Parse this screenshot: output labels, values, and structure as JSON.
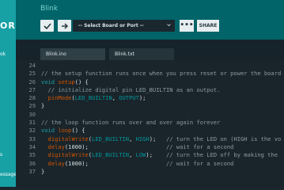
{
  "sidebar": {
    "logo_text": "OR",
    "items": [
      "ok",
      "s",
      "essage"
    ]
  },
  "header": {
    "sketch_name": "Blink",
    "board_placeholder": "-- Select Board or Port --",
    "more_label": "•••",
    "share_label": "SHARE"
  },
  "tabs": [
    {
      "label": "Blink.ino"
    },
    {
      "label": "Blink.txt"
    }
  ],
  "editor": {
    "line_numbers": [
      "24",
      "25",
      "26",
      "27",
      "28",
      "29",
      "30",
      "31",
      "32",
      "33",
      "34",
      "35",
      "36",
      "37"
    ],
    "lines": [
      {
        "segments": [
          {
            "t": "",
            "c": "plain"
          }
        ]
      },
      {
        "segments": [
          {
            "t": "// the setup function runs once when you press reset or power the board",
            "c": "cmt"
          }
        ]
      },
      {
        "segments": [
          {
            "t": "void ",
            "c": "kw"
          },
          {
            "t": "setup",
            "c": "fn"
          },
          {
            "t": "() {",
            "c": "plain"
          }
        ]
      },
      {
        "segments": [
          {
            "t": "  // initialize digital pin LED_BUILTIN as an output.",
            "c": "cmt"
          }
        ]
      },
      {
        "segments": [
          {
            "t": "  ",
            "c": "plain"
          },
          {
            "t": "pinMode",
            "c": "fn"
          },
          {
            "t": "(",
            "c": "plain"
          },
          {
            "t": "LED_BUILTIN",
            "c": "cst"
          },
          {
            "t": ", ",
            "c": "plain"
          },
          {
            "t": "OUTPUT",
            "c": "cst"
          },
          {
            "t": ");",
            "c": "plain"
          }
        ]
      },
      {
        "segments": [
          {
            "t": "}",
            "c": "plain"
          }
        ]
      },
      {
        "segments": [
          {
            "t": "",
            "c": "plain"
          }
        ]
      },
      {
        "segments": [
          {
            "t": "// the loop function runs over and over again forever",
            "c": "cmt"
          }
        ]
      },
      {
        "segments": [
          {
            "t": "void ",
            "c": "kw"
          },
          {
            "t": "loop",
            "c": "fn"
          },
          {
            "t": "() {",
            "c": "plain"
          }
        ]
      },
      {
        "segments": [
          {
            "t": "  ",
            "c": "plain"
          },
          {
            "t": "digitalWrite",
            "c": "fn"
          },
          {
            "t": "(",
            "c": "plain"
          },
          {
            "t": "LED_BUILTIN",
            "c": "cst"
          },
          {
            "t": ", ",
            "c": "plain"
          },
          {
            "t": "HIGH",
            "c": "cst"
          },
          {
            "t": ");   ",
            "c": "plain"
          },
          {
            "t": "// turn the LED on (HIGH is the vo",
            "c": "cmt"
          }
        ]
      },
      {
        "segments": [
          {
            "t": "  ",
            "c": "plain"
          },
          {
            "t": "delay",
            "c": "fn"
          },
          {
            "t": "(1000);                       ",
            "c": "plain"
          },
          {
            "t": "// wait for a second",
            "c": "cmt"
          }
        ]
      },
      {
        "segments": [
          {
            "t": "  ",
            "c": "plain"
          },
          {
            "t": "digitalWrite",
            "c": "fn"
          },
          {
            "t": "(",
            "c": "plain"
          },
          {
            "t": "LED_BUILTIN",
            "c": "cst"
          },
          {
            "t": ", ",
            "c": "plain"
          },
          {
            "t": "LOW",
            "c": "cst"
          },
          {
            "t": ");    ",
            "c": "plain"
          },
          {
            "t": "// turn the LED off by making the",
            "c": "cmt"
          }
        ]
      },
      {
        "segments": [
          {
            "t": "  ",
            "c": "plain"
          },
          {
            "t": "delay",
            "c": "fn"
          },
          {
            "t": "(1000);                       ",
            "c": "plain"
          },
          {
            "t": "// wait for a second",
            "c": "cmt"
          }
        ]
      },
      {
        "segments": [
          {
            "t": "}",
            "c": "plain"
          }
        ]
      }
    ]
  },
  "colors": {
    "sidebar": "#17a1a5",
    "topbar": "#006468",
    "editor_bg": "#1a252b",
    "keyword": "#17a1a5",
    "function": "#d35400",
    "constant": "#00979c",
    "comment": "#8a9aa2"
  }
}
